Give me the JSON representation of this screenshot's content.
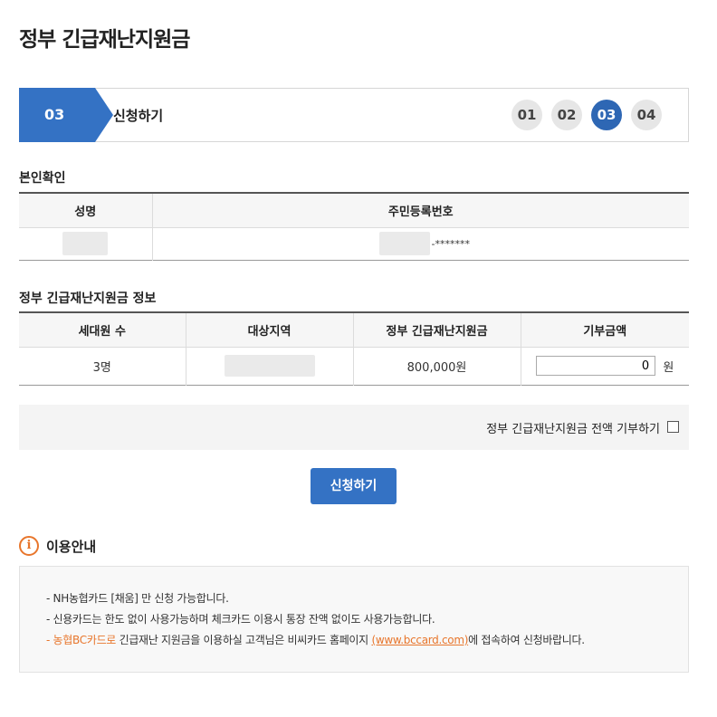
{
  "page": {
    "title": "정부 긴급재난지원금"
  },
  "stepbar": {
    "current_number": "03",
    "current_label": "신청하기",
    "steps": [
      "01",
      "02",
      "03",
      "04"
    ]
  },
  "identity": {
    "section_title": "본인확인",
    "headers": [
      "성명",
      "주민등록번호"
    ],
    "masked_suffix": "-*******"
  },
  "support_info": {
    "section_title": "정부 긴급재난지원금 정보",
    "headers": [
      "세대원 수",
      "대상지역",
      "정부 긴급재난지원금",
      "기부금액"
    ],
    "household": "3명",
    "amount": "800,000원",
    "donation_value": "0",
    "donation_unit": "원"
  },
  "donate_all": {
    "label": "정부 긴급재난지원금 전액 기부하기"
  },
  "submit_label": "신청하기",
  "guide": {
    "title": "이용안내",
    "icon": "info-icon",
    "lines": [
      "- NH농협카드 [채움] 만 신청 가능합니다.",
      "- 신용카드는 한도 없이 사용가능하며 체크카드 이용시 통장 잔액 없이도 사용가능합니다."
    ],
    "line3_prefix": "- ",
    "line3_brand": "농협BC카드로",
    "line3_mid": " 긴급재난 지원금을 이용하실 고객님은 비씨카드 홈페이지 ",
    "line3_link": "(www.bccard.com)",
    "line3_suffix": "에 접속하여 신청바랍니다."
  },
  "colors": {
    "accent": "#3472c4",
    "orange": "#e8762c"
  }
}
